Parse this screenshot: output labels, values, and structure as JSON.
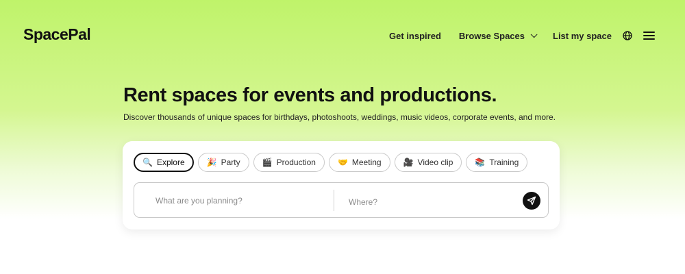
{
  "header": {
    "logo": "SpacePal",
    "nav": {
      "get_inspired": "Get inspired",
      "browse_spaces": "Browse Spaces",
      "list_my_space": "List my space"
    },
    "icons": [
      "chevron-down-icon",
      "globe-icon",
      "hamburger-menu-icon"
    ]
  },
  "hero": {
    "title": "Rent spaces for events and productions.",
    "subtitle": "Discover thousands of unique spaces for birthdays, photoshoots, weddings, music videos, corporate events, and more."
  },
  "categories": [
    {
      "label": "Explore",
      "icon": "🔍",
      "icon_name": "magnifier-icon",
      "active": true
    },
    {
      "label": "Party",
      "icon": "🎉",
      "icon_name": "party-popper-icon",
      "active": false
    },
    {
      "label": "Production",
      "icon": "🎬",
      "icon_name": "clapperboard-icon",
      "active": false
    },
    {
      "label": "Meeting",
      "icon": "🤝",
      "icon_name": "handshake-icon",
      "active": false
    },
    {
      "label": "Video clip",
      "icon": "🎥",
      "icon_name": "video-camera-icon",
      "active": false
    },
    {
      "label": "Training",
      "icon": "📚",
      "icon_name": "books-icon",
      "active": false
    }
  ],
  "search": {
    "plan_placeholder": "What are you planning?",
    "plan_value": "",
    "where_placeholder": "Where?",
    "where_value": "",
    "submit_icon": "send-arrow-icon"
  },
  "colors": {
    "background_top": "#bff36a",
    "background_bottom": "#ffffff",
    "text": "#111111",
    "button": "#111111"
  }
}
